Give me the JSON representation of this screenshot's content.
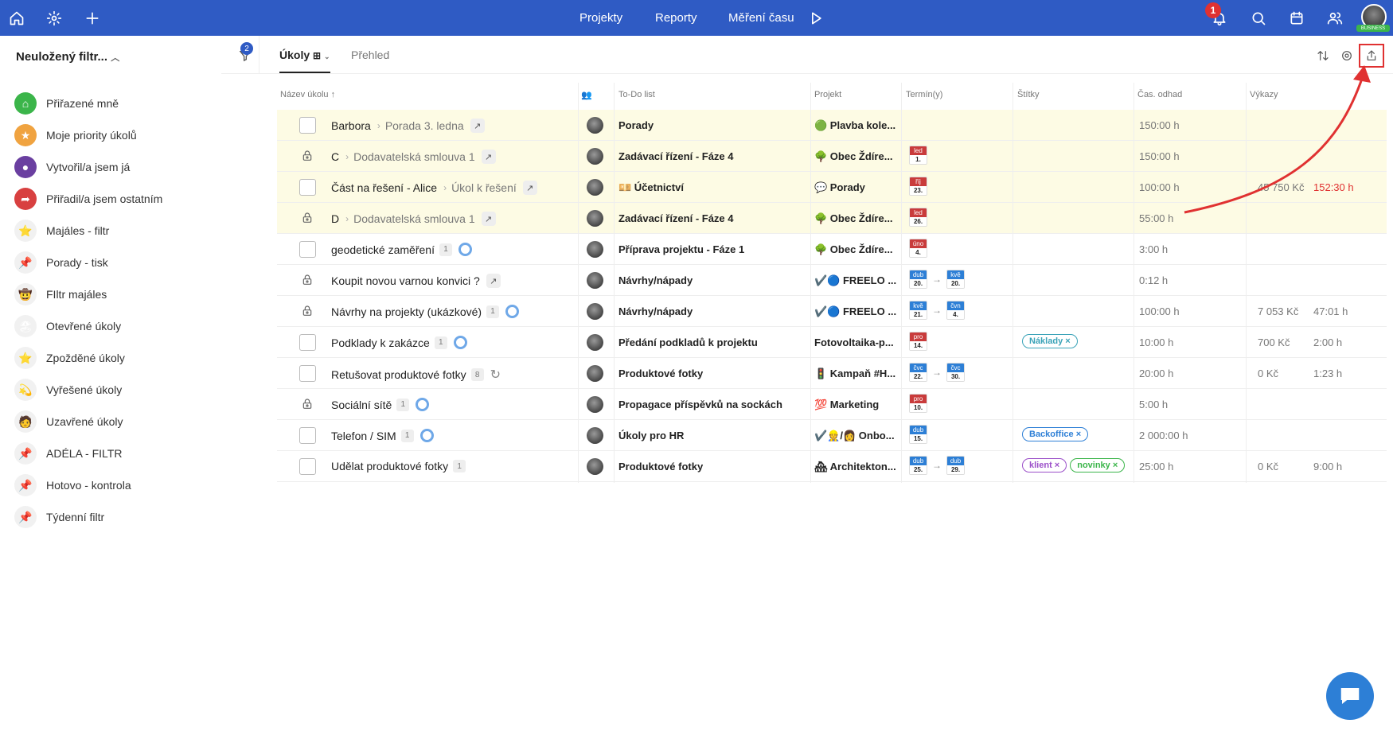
{
  "topbar": {
    "nav": [
      "Projekty",
      "Reporty",
      "Měření času"
    ],
    "notification_count": "1",
    "badge": "BUSINESS"
  },
  "sidebar": {
    "title": "Neuložený filtr...",
    "items": [
      {
        "label": "Přiřazené mně",
        "icon": "home-icon",
        "color": "#3bb54a",
        "glyph": "⌂"
      },
      {
        "label": "Moje priority úkolů",
        "icon": "star-icon",
        "color": "#f0a340",
        "glyph": "★"
      },
      {
        "label": "Vytvořil/a jsem já",
        "icon": "user-icon",
        "color": "#6a3fa0",
        "glyph": "●"
      },
      {
        "label": "Přiřadil/a jsem ostatním",
        "icon": "share-icon",
        "color": "#d84040",
        "glyph": "➦"
      },
      {
        "label": "Majáles - filtr",
        "icon": "star-emoji-icon",
        "color": "",
        "glyph": "⭐"
      },
      {
        "label": "Porady - tisk",
        "icon": "pin-icon",
        "color": "",
        "glyph": "📌"
      },
      {
        "label": "FIltr majáles",
        "icon": "cowboy-icon",
        "color": "",
        "glyph": "🤠"
      },
      {
        "label": "Otevřené úkoly",
        "icon": "beach-icon",
        "color": "",
        "glyph": "🏖"
      },
      {
        "label": "Zpožděné úkoly",
        "icon": "star-emoji-icon",
        "color": "",
        "glyph": "⭐"
      },
      {
        "label": "Vyřešené úkoly",
        "icon": "comet-icon",
        "color": "",
        "glyph": "💫"
      },
      {
        "label": "Uzavřené úkoly",
        "icon": "robot-icon",
        "color": "",
        "glyph": "🧑"
      },
      {
        "label": "ADÉLA - FILTR",
        "icon": "pin-icon",
        "color": "",
        "glyph": "📌"
      },
      {
        "label": "Hotovo - kontrola",
        "icon": "pin-icon",
        "color": "",
        "glyph": "📌"
      },
      {
        "label": "Týdenní filtr",
        "icon": "pin-icon",
        "color": "",
        "glyph": "📌"
      }
    ]
  },
  "filter_badge": "2",
  "tabs": [
    {
      "label": "Úkoly"
    },
    {
      "label": "Přehled"
    }
  ],
  "columns": [
    "Název úkolu",
    "To-Do list",
    "Projekt",
    "Termín(y)",
    "Štítky",
    "Čas. odhad",
    "Výkazy"
  ],
  "rows": [
    {
      "name": "Barbora",
      "parent": "Porada 3. ledna",
      "todo": "Porady",
      "project": "🟢 Plavba kole...",
      "dates": [],
      "tags": [],
      "estimate": "150:00 h",
      "rep1": "",
      "rep2": "",
      "hl": true,
      "locked": false
    },
    {
      "name": "C",
      "parent": "Dodavatelská smlouva 1",
      "todo": "Zadávací řízení - Fáze 4",
      "project": "🌳 Obec Ždíre...",
      "dates": [
        {
          "m": "led",
          "d": "1.",
          "c": "#c93b3b"
        }
      ],
      "tags": [],
      "estimate": "150:00 h",
      "rep1": "",
      "rep2": "",
      "hl": true,
      "locked": true
    },
    {
      "name": "Část na řešení - Alice",
      "parent": "Úkol k řešení",
      "todo": "💴 Účetnictví",
      "project": "💬 Porady",
      "dates": [
        {
          "m": "říj",
          "d": "23.",
          "c": "#c93b3b"
        }
      ],
      "tags": [],
      "estimate": "100:00 h",
      "rep1": "45 750 Kč",
      "rep2": "152:30 h",
      "rep2red": true,
      "hl": true,
      "locked": false
    },
    {
      "name": "D",
      "parent": "Dodavatelská smlouva 1",
      "todo": "Zadávací řízení - Fáze 4",
      "project": "🌳 Obec Ždíre...",
      "dates": [
        {
          "m": "led",
          "d": "26.",
          "c": "#c93b3b"
        }
      ],
      "tags": [],
      "estimate": "55:00 h",
      "rep1": "",
      "rep2": "",
      "hl": true,
      "locked": true
    },
    {
      "name": "geodetické zaměření",
      "count": "1",
      "ring": true,
      "todo": "Příprava projektu - Fáze 1",
      "project": "🌳 Obec Ždíre...",
      "dates": [
        {
          "m": "úno",
          "d": "4.",
          "c": "#c93b3b"
        }
      ],
      "tags": [],
      "estimate": "3:00 h",
      "rep1": "",
      "rep2": "",
      "hl": false,
      "locked": false
    },
    {
      "name": "Koupit novou varnou konvici ?",
      "go": true,
      "todo": "Návrhy/nápady",
      "project": "✔️🔵 FREELO ...",
      "dates": [
        {
          "m": "dub",
          "d": "20.",
          "c": "#2d7fd6"
        },
        {
          "m": "kvě",
          "d": "20.",
          "c": "#2d7fd6"
        }
      ],
      "tags": [],
      "estimate": "0:12 h",
      "rep1": "",
      "rep2": "",
      "hl": false,
      "locked": true
    },
    {
      "name": "Návrhy na projekty (ukázkové)",
      "count": "1",
      "ring": true,
      "todo": "Návrhy/nápady",
      "project": "✔️🔵 FREELO ...",
      "dates": [
        {
          "m": "kvě",
          "d": "21.",
          "c": "#2d7fd6"
        },
        {
          "m": "čvn",
          "d": "4.",
          "c": "#2d7fd6"
        }
      ],
      "tags": [],
      "estimate": "100:00 h",
      "rep1": "7 053 Kč",
      "rep2": "47:01 h",
      "hl": false,
      "locked": true
    },
    {
      "name": "Podklady k zakázce",
      "count": "1",
      "ring": true,
      "todo": "Předání podkladů k projektu",
      "project": "Fotovoltaika-p...",
      "dates": [
        {
          "m": "pro",
          "d": "14.",
          "c": "#c93b3b"
        }
      ],
      "tags": [
        {
          "t": "Náklady",
          "c": "#3aa3b8"
        }
      ],
      "estimate": "10:00 h",
      "rep1": "700 Kč",
      "rep2": "2:00 h",
      "hl": false,
      "locked": false
    },
    {
      "name": "Retušovat produktové fotky",
      "count": "8",
      "repeat": true,
      "todo": "Produktové fotky",
      "project": "🚦 Kampaň #H...",
      "dates": [
        {
          "m": "čvc",
          "d": "22.",
          "c": "#2d7fd6"
        },
        {
          "m": "čvc",
          "d": "30.",
          "c": "#2d7fd6"
        }
      ],
      "tags": [],
      "estimate": "20:00 h",
      "rep1": "0 Kč",
      "rep2": "1:23 h",
      "hl": false,
      "locked": false
    },
    {
      "name": "Sociální sítě",
      "count": "1",
      "ring": true,
      "todo": "Propagace příspěvků na sockách",
      "project": "💯 Marketing",
      "dates": [
        {
          "m": "pro",
          "d": "10.",
          "c": "#c93b3b"
        }
      ],
      "tags": [],
      "estimate": "5:00 h",
      "rep1": "",
      "rep2": "",
      "hl": false,
      "locked": true
    },
    {
      "name": "Telefon / SIM",
      "count": "1",
      "ring": true,
      "todo": "Úkoly pro HR",
      "project": "✔️👷/👩 Onbo...",
      "dates": [
        {
          "m": "dub",
          "d": "15.",
          "c": "#2d7fd6"
        }
      ],
      "tags": [
        {
          "t": "Backoffice",
          "c": "#2d7fd6"
        }
      ],
      "estimate": "2 000:00 h",
      "rep1": "",
      "rep2": "",
      "hl": false,
      "locked": false
    },
    {
      "name": "Udělat produktové fotky",
      "count": "1",
      "todo": "Produktové fotky",
      "project": "🏘 Architekton...",
      "dates": [
        {
          "m": "dub",
          "d": "25.",
          "c": "#2d7fd6"
        },
        {
          "m": "dub",
          "d": "29.",
          "c": "#2d7fd6"
        }
      ],
      "tags": [
        {
          "t": "klient",
          "c": "#9b4fc9"
        },
        {
          "t": "novinky",
          "c": "#3bb54a"
        }
      ],
      "estimate": "25:00 h",
      "rep1": "0 Kč",
      "rep2": "9:00 h",
      "hl": false,
      "locked": false
    }
  ],
  "colors": {
    "topbar": "#2f5bc4",
    "highlight_row": "#fdfbe4",
    "annotation": "#e03131"
  }
}
